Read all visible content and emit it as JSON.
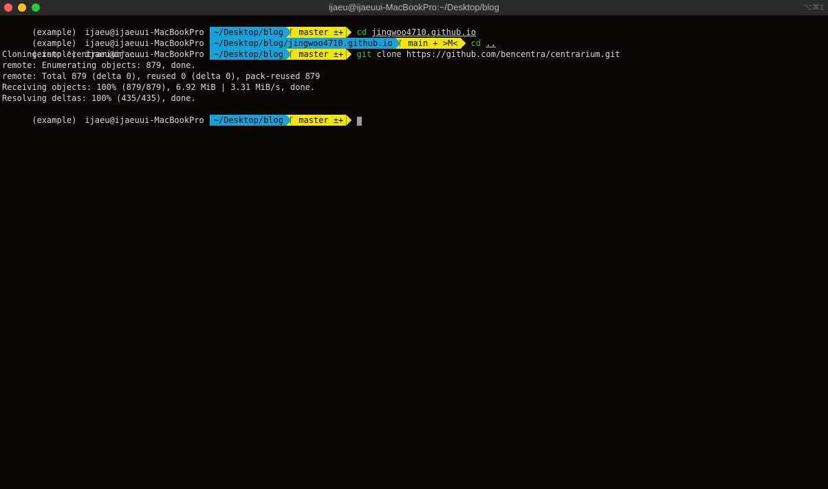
{
  "window": {
    "title": "ijaeu@ijaeuui-MacBookPro:~/Desktop/blog",
    "shortcut": "⌥⌘1"
  },
  "icons": {
    "branch": "branch-icon"
  },
  "colors": {
    "background": "#0b0606",
    "path_segment": "#1aa1d8",
    "git_segment": "#f2e40d",
    "command": "#38c04b"
  },
  "terminal": {
    "branch_glyph": "ᚴ",
    "lines": [
      {
        "type": "prompt",
        "env": "(example)",
        "user": "ijaeu@ijaeuui-MacBookPro",
        "path": "~/Desktop/blog",
        "git": "master ±+",
        "cmd": "cd",
        "arg": "jingwoo4710.github.io"
      },
      {
        "type": "prompt",
        "env": "(example)",
        "user": "ijaeu@ijaeuui-MacBookPro",
        "path": "~/Desktop/blog/jingwoo4710.github.io",
        "git": "main + >M<",
        "cmd": "cd",
        "arg": ".."
      },
      {
        "type": "prompt",
        "env": "(example)",
        "user": "ijaeu@ijaeuui-MacBookPro",
        "path": "~/Desktop/blog",
        "git": "master ±+",
        "cmd": "git",
        "arg": "clone https://github.com/bencentra/centrarium.git"
      },
      {
        "type": "output",
        "text": "Cloning into 'centrarium'..."
      },
      {
        "type": "output",
        "text": "remote: Enumerating objects: 879, done."
      },
      {
        "type": "output",
        "text": "remote: Total 879 (delta 0), reused 0 (delta 0), pack-reused 879"
      },
      {
        "type": "output",
        "text": "Receiving objects: 100% (879/879), 6.92 MiB | 3.31 MiB/s, done."
      },
      {
        "type": "output",
        "text": "Resolving deltas: 100% (435/435), done."
      },
      {
        "type": "prompt",
        "env": "(example)",
        "user": "ijaeu@ijaeuui-MacBookPro",
        "path": "~/Desktop/blog",
        "git": "master ±+",
        "cmd": "",
        "arg": ""
      }
    ]
  }
}
